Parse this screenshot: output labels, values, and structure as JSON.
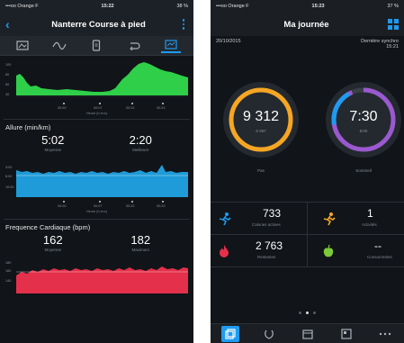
{
  "left": {
    "status": {
      "carrier": "•••oo Orange F",
      "time": "15:22",
      "battery": "38 %"
    },
    "header": {
      "title": "Nanterre Course à pied"
    },
    "tabs": [
      "summary-tab-icon",
      "splits-wave-icon",
      "device-icon",
      "laps-icon",
      "chart-icon"
    ],
    "elevation": {
      "y_ticks": [
        "100",
        "80",
        "60",
        "40"
      ],
      "x_ticks": [
        "00:00",
        "00:07",
        "00:22",
        "00:23"
      ],
      "x_title": "Heure (h:m:s)",
      "color": "#2fcf49"
    },
    "pace": {
      "title": "Allure (min/km)",
      "avg_value": "5:02",
      "avg_label": "Moyenne",
      "best_value": "2:20",
      "best_label": "Meilleure",
      "y_ticks": [
        "3:00",
        "6:00",
        "10:00"
      ],
      "x_ticks": [
        "00:00",
        "00:07",
        "00:22",
        "00:23"
      ],
      "x_title": "Heure (h:m:s)",
      "color": "#1e9bd8"
    },
    "heart": {
      "title": "Frequence Cardiaque (bpm)",
      "avg_value": "162",
      "avg_label": "Moyenne",
      "max_value": "182",
      "max_label": "Maximum",
      "y_ticks": [
        "180",
        "160",
        "140"
      ],
      "color": "#e4304a"
    }
  },
  "right": {
    "status": {
      "carrier": "•••oo Orange F",
      "time": "15:23",
      "battery": "37 %"
    },
    "header": {
      "title": "Ma journée"
    },
    "date": "20/10/2015",
    "sync": "Dernière synchro",
    "sync_time": "15:21",
    "steps": {
      "value": "9 312",
      "goal": "6 097",
      "label": "Pas",
      "color": "#f5a623"
    },
    "sleep": {
      "value": "7:30",
      "goal": "8:00",
      "label": "Sommeil",
      "color": "#9b59d0"
    },
    "tiles": {
      "calories": {
        "value": "733",
        "label": "Calories actives"
      },
      "activities": {
        "value": "1",
        "label": "Activités"
      },
      "remaining": {
        "value": "2 763",
        "label": "Restantes"
      },
      "consumed": {
        "value": "--",
        "label": "Consommées"
      }
    },
    "page_dots": 3,
    "active_dot": 1
  }
}
